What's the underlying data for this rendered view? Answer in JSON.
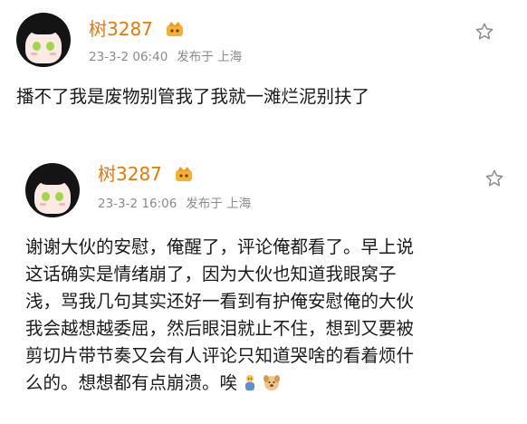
{
  "posts": [
    {
      "username": "树3287",
      "date": "23-3-2 06:40",
      "location": "发布于 上海",
      "text": "播不了我是废物别管我了我就一滩烂泥别扶了"
    },
    {
      "username": "树3287",
      "date": "23-3-2 16:06",
      "location": "发布于 上海",
      "lines": [
        "谢谢大伙的安慰，俺醒了，评论俺都看了。早上说",
        "这话确实是情绪崩了，因为大伙也知道我眼窝子",
        "浅，骂我几句其实还好一看到有护俺安慰俺的大伙",
        "我会越想越委屈，然后眼泪就止不住，想到又要被",
        "剪切片带节奏又会有人评论只知道哭啥的看着烦什",
        "么的。想想都有点崩溃。唉"
      ],
      "emojis": [
        "sad-figure-emoji",
        "dog-emoji"
      ]
    }
  ],
  "colors": {
    "username": "#e07a10",
    "meta": "#8a8a8a",
    "text": "#1a1a1a"
  }
}
